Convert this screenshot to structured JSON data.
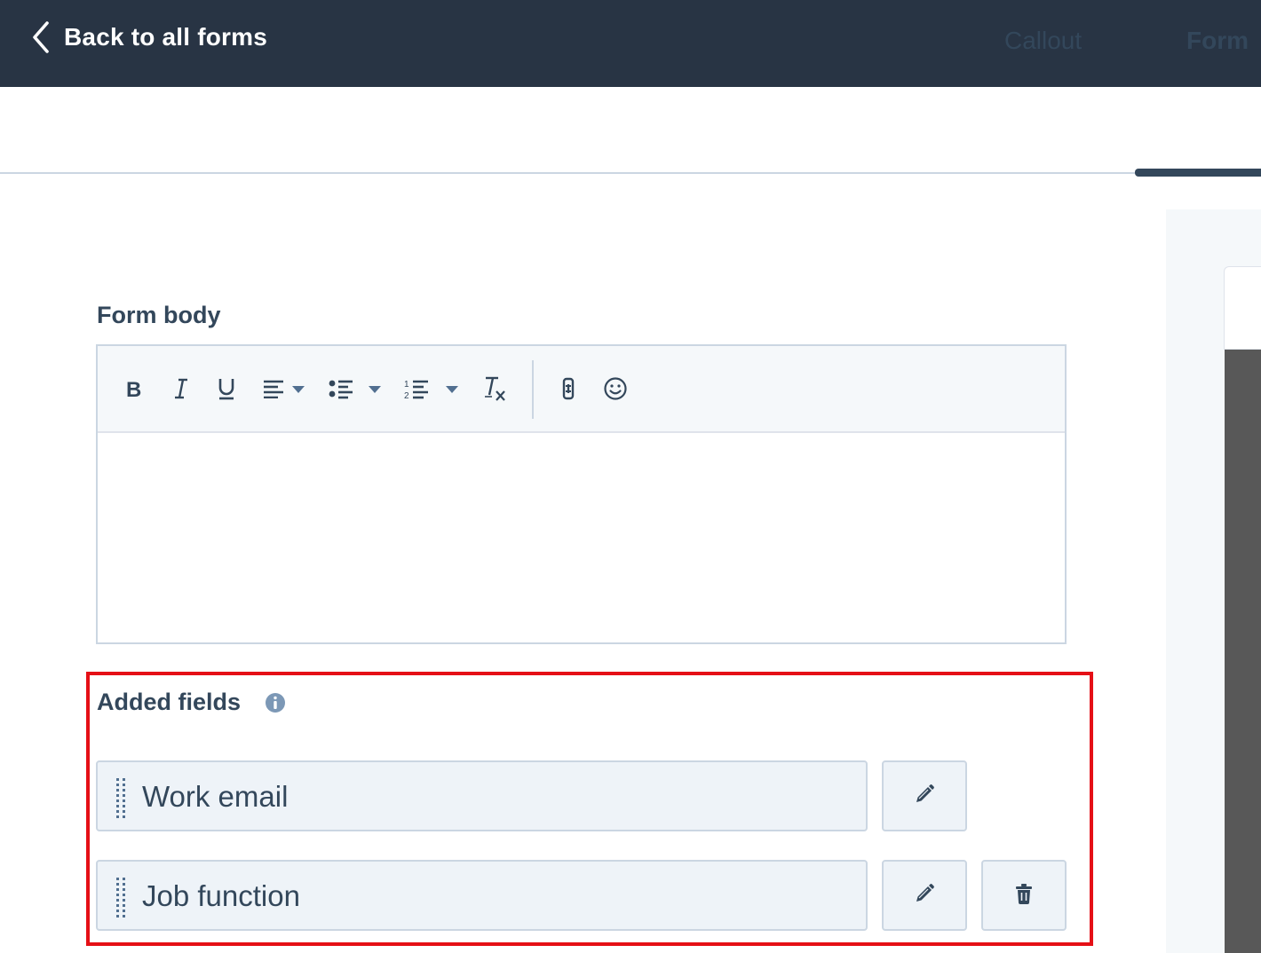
{
  "header": {
    "back_label": "Back to all forms",
    "back_icon": "chevron-left-icon",
    "background_color": "#283444"
  },
  "tabs": [
    {
      "label": "Callout",
      "active": false
    },
    {
      "label": "Form",
      "active": true
    }
  ],
  "form_body": {
    "label": "Form body",
    "content": "",
    "toolbar": [
      {
        "icon": "bold-icon"
      },
      {
        "icon": "italic-icon"
      },
      {
        "icon": "underline-icon"
      },
      {
        "icon": "align-left-icon",
        "dropdown": true
      },
      {
        "icon": "bulleted-list-icon",
        "dropdown": true
      },
      {
        "icon": "numbered-list-icon",
        "dropdown": true
      },
      {
        "icon": "clear-formatting-icon"
      },
      {
        "icon": "personalize-token-icon"
      },
      {
        "icon": "emoji-icon"
      }
    ]
  },
  "added_fields": {
    "label": "Added fields",
    "info_icon": "info-icon",
    "highlight_color": "#e50f16",
    "fields": [
      {
        "label": "Work email",
        "actions": [
          "edit"
        ]
      },
      {
        "label": "Job function",
        "actions": [
          "edit",
          "delete"
        ]
      }
    ]
  }
}
